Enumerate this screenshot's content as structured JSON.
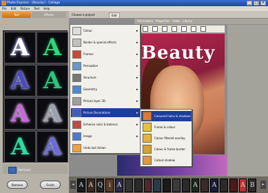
{
  "window": {
    "title": "Photo Express - [Beauty] - Collage",
    "min": "_",
    "max": "□",
    "close": "×"
  },
  "menubar": [
    "File",
    "Edit",
    "Picture",
    "Text",
    "Help"
  ],
  "left_panel": {
    "tab_active": "Text",
    "tab_other": "Effects",
    "tiles": [
      {
        "letter": "A",
        "color": "#ffffff",
        "glow": "#bfbfff"
      },
      {
        "letter": "A",
        "color": "#2fd67a",
        "glow": "#0a5a2a"
      },
      {
        "letter": "A",
        "color": "#4a4ab8",
        "glow": "#b0b0ff"
      },
      {
        "letter": "A",
        "color": "#31c081",
        "glow": "#0a4a2a"
      },
      {
        "letter": "A",
        "color": "#c46ad8",
        "glow": "#f0c0ff"
      },
      {
        "letter": "A",
        "color": "#9aa0ad",
        "glow": "#ffffff"
      },
      {
        "letter": "A",
        "color": "#2fd9a0",
        "glow": "#0a5a40"
      },
      {
        "letter": "A",
        "color": "#6a6ad8",
        "glow": "#c0c0ff"
      }
    ],
    "checkbox_label": "Add label",
    "btn_left": "Remove",
    "btn_right": "Finish"
  },
  "tabs": {
    "left": "Choose a project",
    "active": "Edit",
    "right": [
      "Information",
      "Properties",
      "Index",
      "Library"
    ]
  },
  "menu": {
    "items": [
      {
        "label": "Colour",
        "icon": "#dcdcdc",
        "arrow": "▸"
      },
      {
        "label": "Border & special effects",
        "icon": "#c0c0c0",
        "arrow": "▸"
      },
      {
        "label": "Frames",
        "icon": "#c84b3a",
        "arrow": "▸"
      },
      {
        "label": "Perception",
        "icon": "#6699cc",
        "arrow": "▸"
      },
      {
        "label": "Structure",
        "icon": "#777777",
        "arrow": "▸"
      },
      {
        "label": "Geometry",
        "icon": "#4a8ad6",
        "arrow": "▸"
      },
      {
        "label": "Picture layer 3D",
        "icon": "#a0a0a0",
        "arrow": "▸"
      },
      {
        "label": "Picture Decorations",
        "icon": "#3a5fc0",
        "arrow": "▸"
      },
      {
        "label": "Enhance color & balance",
        "icon": "#c04848",
        "arrow": "▸"
      },
      {
        "label": "Image",
        "icon": "#4a7bd0",
        "arrow": "▸"
      },
      {
        "label": "Undo last Action",
        "icon": "#f0a040",
        "arrow": ""
      }
    ],
    "highlighted_index": 7
  },
  "submenu": {
    "items": [
      {
        "label": "Coloured halos & shadows",
        "icon": "#e07a2a"
      },
      {
        "label": "Frame & colour",
        "icon": "#e8c040"
      },
      {
        "label": "Colour filtered overlay",
        "icon": "#e8b040"
      },
      {
        "label": "Colour & frame border",
        "icon": "#d8a030"
      },
      {
        "label": "Cutout shadow",
        "icon": "#e09a3a"
      }
    ],
    "highlighted_index": 0
  },
  "photo": {
    "headline": "Beauty"
  },
  "filmstrip": {
    "thumbs": [
      "A",
      "A",
      "Q",
      "i",
      "A",
      "",
      "",
      "",
      "",
      "",
      "",
      "",
      "A",
      "",
      "A",
      "",
      "",
      "A",
      "B"
    ]
  }
}
